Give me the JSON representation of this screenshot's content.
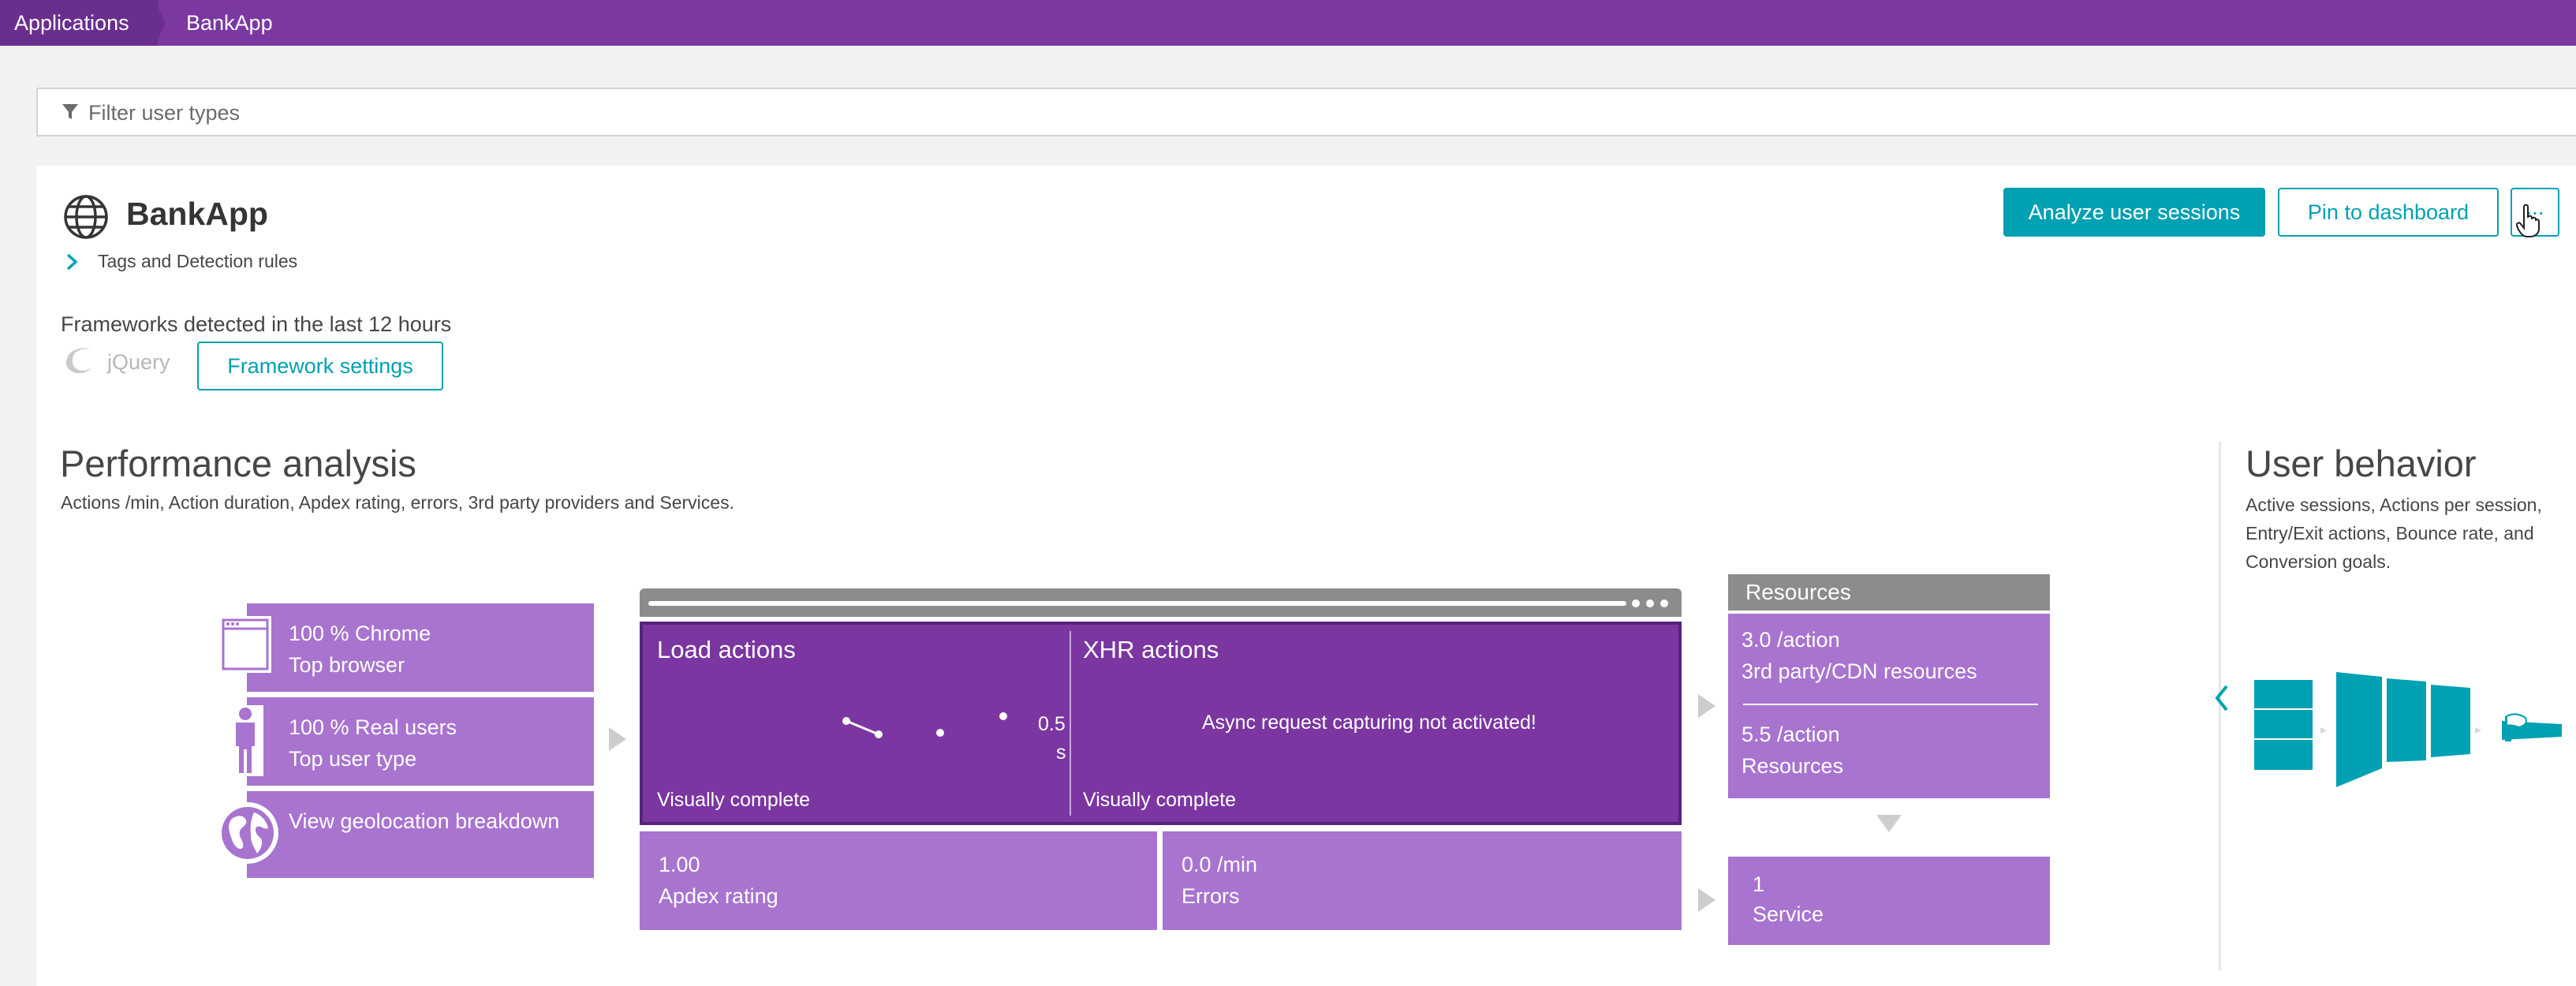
{
  "breadcrumb": {
    "root": "Applications",
    "current": "BankApp"
  },
  "filter": {
    "placeholder": "Filter user types"
  },
  "app": {
    "name": "BankApp",
    "tags_label": "Tags and Detection rules"
  },
  "frameworks": {
    "label": "Frameworks detected in the last 12 hours",
    "items": [
      "jQuery"
    ],
    "settings_button": "Framework settings"
  },
  "actions": {
    "analyze": "Analyze user sessions",
    "pin": "Pin to dashboard",
    "more": "..."
  },
  "performance": {
    "title": "Performance analysis",
    "subtitle": "Actions /min, Action duration, Apdex rating, errors, 3rd party providers and Services.",
    "tiles": {
      "browser": {
        "value": "100 % Chrome",
        "label": "Top browser"
      },
      "user_type": {
        "value": "100 % Real users",
        "label": "Top user type"
      },
      "geo": {
        "label": "View geolocation breakdown"
      }
    },
    "load": {
      "title": "Load actions",
      "metric": "Visually complete",
      "axis_value": "0.5",
      "axis_unit": "s"
    },
    "xhr": {
      "title": "XHR actions",
      "metric": "Visually complete",
      "message": "Async request capturing not activated!"
    },
    "apdex": {
      "value": "1.00",
      "label": "Apdex rating"
    },
    "errors": {
      "value": "0.0 /min",
      "label": "Errors"
    },
    "resources": {
      "header": "Resources",
      "third_party": {
        "value": "3.0 /action",
        "label": "3rd party/CDN resources"
      },
      "own": {
        "value": "5.5 /action",
        "label": "Resources"
      }
    },
    "service": {
      "value": "1",
      "label": "Service"
    }
  },
  "user_behavior": {
    "title": "User behavior",
    "subtitle": "Active sessions, Actions per session, Entry/Exit actions, Bounce rate, and Conversion goals."
  },
  "colors": {
    "brand": "#7c38a1",
    "accent": "#00a1b2",
    "tile": "#a874cf",
    "panel": "#7b36a1"
  }
}
